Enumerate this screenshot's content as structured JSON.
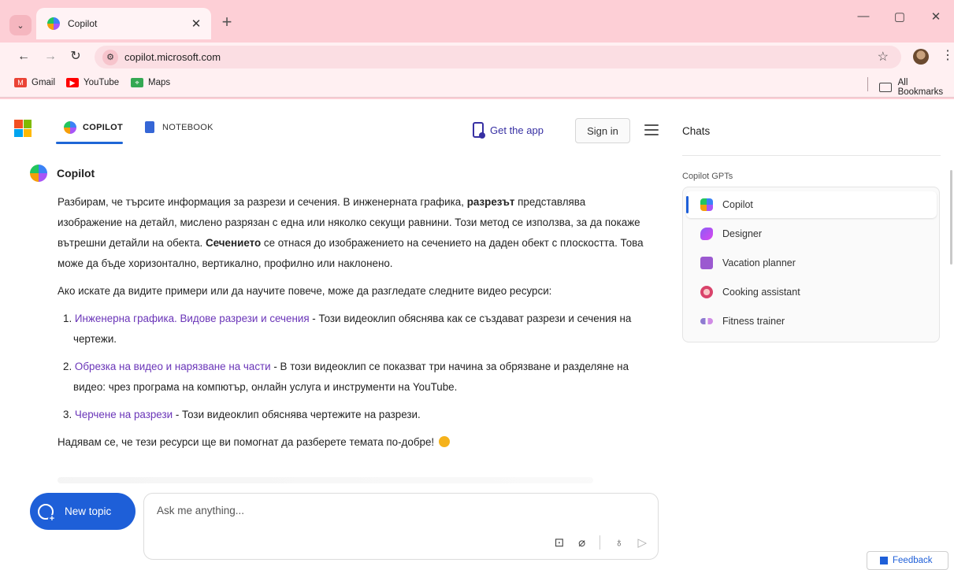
{
  "browser": {
    "tab_title": "Copilot",
    "tab_close": "✕",
    "new_tab": "+",
    "url": "copilot.microsoft.com",
    "window_controls": [
      "—",
      "▢",
      "✕"
    ],
    "bookmarks": [
      {
        "label": "Gmail",
        "icon": "gmail-icon",
        "color": "#ea4335"
      },
      {
        "label": "YouTube",
        "icon": "youtube-icon",
        "color": "#ff0000"
      },
      {
        "label": "Maps",
        "icon": "maps-icon",
        "color": "#34a853"
      }
    ],
    "all_bookmarks": "All Bookmarks"
  },
  "header": {
    "tabs": [
      {
        "label": "COPILOT",
        "active": true
      },
      {
        "label": "NOTEBOOK",
        "active": false
      }
    ],
    "get_app": "Get the app",
    "sign_in": "Sign in"
  },
  "message": {
    "author": "Copilot",
    "p1_a": "Разбирам, че търсите информация за разрези и сечения. В инженерната графика, ",
    "p1_bold1": "разрезът",
    "p1_b": " представлява изображение на детайл, мислено разрязан с една или няколко секущи равнини. Този метод се използва, за да покаже вътрешни детайли на обекта. ",
    "p1_bold2": "Сечението",
    "p1_c": " се отнася до изображението на сечението на даден обект с плоскостта. Това може да бъде хоризонтално, вертикално, профилно или наклонено.",
    "p2": "Ако искате да видите примери или да научите повече, може да разгледате следните видео ресурси:",
    "links": [
      {
        "num": "1.",
        "title": "Инженерна графика. Видове разрези и сечения",
        "desc": " - Този видеоклип обяснява как се създават разрези и сечения на чертежи."
      },
      {
        "num": "2.",
        "title": "Обрезка на видео и нарязване на части",
        "desc": " - В този видеоклип се показват три начина за обрязване и разделяне на видео: чрез програма на компютър, онлайн услуга и инструменти на YouTube."
      },
      {
        "num": "3.",
        "title": "Черчене на разрези",
        "desc": " - Този видеоклип обяснява чертежите на разрези."
      }
    ],
    "closing": "Надявам се, че тези ресурси ще ви помогнат да разберете темата по-добре!"
  },
  "composer": {
    "new_topic": "New topic",
    "placeholder": "Ask me anything..."
  },
  "feedback": "Feedback",
  "sidebar": {
    "title": "Chats",
    "section_label": "Copilot GPTs",
    "gpts": [
      {
        "label": "Copilot",
        "icon": "copilot-icon",
        "selected": true
      },
      {
        "label": "Designer",
        "icon": "designer-icon",
        "selected": false
      },
      {
        "label": "Vacation planner",
        "icon": "vacation-planner-icon",
        "selected": false
      },
      {
        "label": "Cooking assistant",
        "icon": "cooking-assistant-icon",
        "selected": false
      },
      {
        "label": "Fitness trainer",
        "icon": "fitness-trainer-icon",
        "selected": false
      }
    ]
  },
  "colors": {
    "chrome_bg": "#fdcfd6",
    "accent": "#1e5fd8",
    "link": "#6a35b8"
  }
}
